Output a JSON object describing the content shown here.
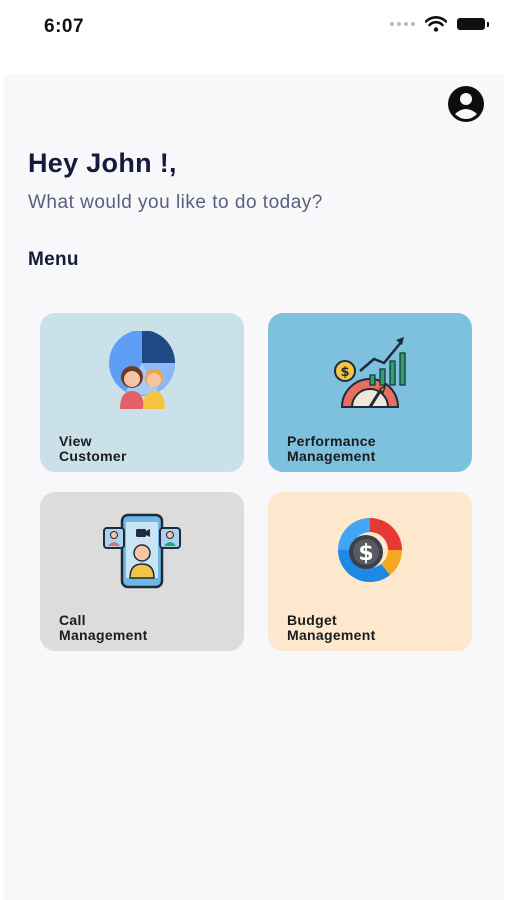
{
  "status_bar": {
    "time": "6:07"
  },
  "header": {
    "greeting": "Hey John !,",
    "subtitle": "What would you like to do today?"
  },
  "menu": {
    "heading": "Menu",
    "items": [
      {
        "label": "View\nCustomer",
        "icon": "customer-chart-icon",
        "color": "#cbe1e9"
      },
      {
        "label": "Performance\nManagement",
        "icon": "performance-growth-icon",
        "color": "#7ec1df"
      },
      {
        "label": "Call\nManagement",
        "icon": "video-call-icon",
        "color": "#dcdcdc"
      },
      {
        "label": "Budget\nManagement",
        "icon": "budget-donut-icon",
        "color": "#fde7cd"
      }
    ]
  }
}
